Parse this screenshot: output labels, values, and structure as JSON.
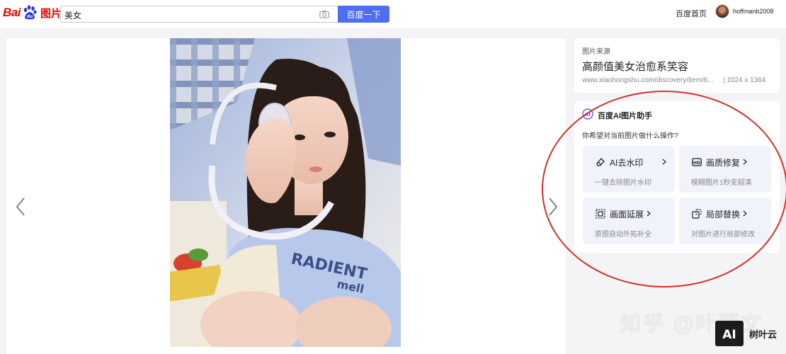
{
  "header": {
    "logo": {
      "bai": "Bai",
      "du": "du",
      "tupian": "图片"
    },
    "search": {
      "value": "美女"
    },
    "search_button": "百度一下",
    "home_link": "百度首页",
    "username": "hoffmanb2008"
  },
  "source": {
    "label": "图片来源",
    "title": "高颜值美女治愈系笑容",
    "url": "www.xiaohongshu.com/discovery/item/6...",
    "size": "| 1024 x 1364"
  },
  "ai_assistant": {
    "title": "百度AI图片助手",
    "question": "你希望对当前图片做什么操作?",
    "tools": [
      {
        "label": "AI去水印",
        "desc": "一键去除图片水印",
        "icon": "eraser-icon"
      },
      {
        "label": "画质修复",
        "desc": "模糊图片1秒变超清",
        "icon": "hd-icon"
      },
      {
        "label": "画面延展",
        "desc": "原图自动外拓补全",
        "icon": "expand-icon"
      },
      {
        "label": "局部替换",
        "desc": "对图片进行局部修改",
        "icon": "replace-icon"
      }
    ]
  },
  "photo": {
    "shirt_text_1": "RADIENT",
    "shirt_text_2": "mell"
  },
  "watermark": {
    "zhihu": "知乎 @叶蓉文",
    "ai_badge": "AI",
    "brand": "树叶云"
  },
  "colors": {
    "accent": "#4e6ef2",
    "logo_red": "#e10601",
    "logo_blue": "#2932e1",
    "annotation": "#d2302c"
  }
}
